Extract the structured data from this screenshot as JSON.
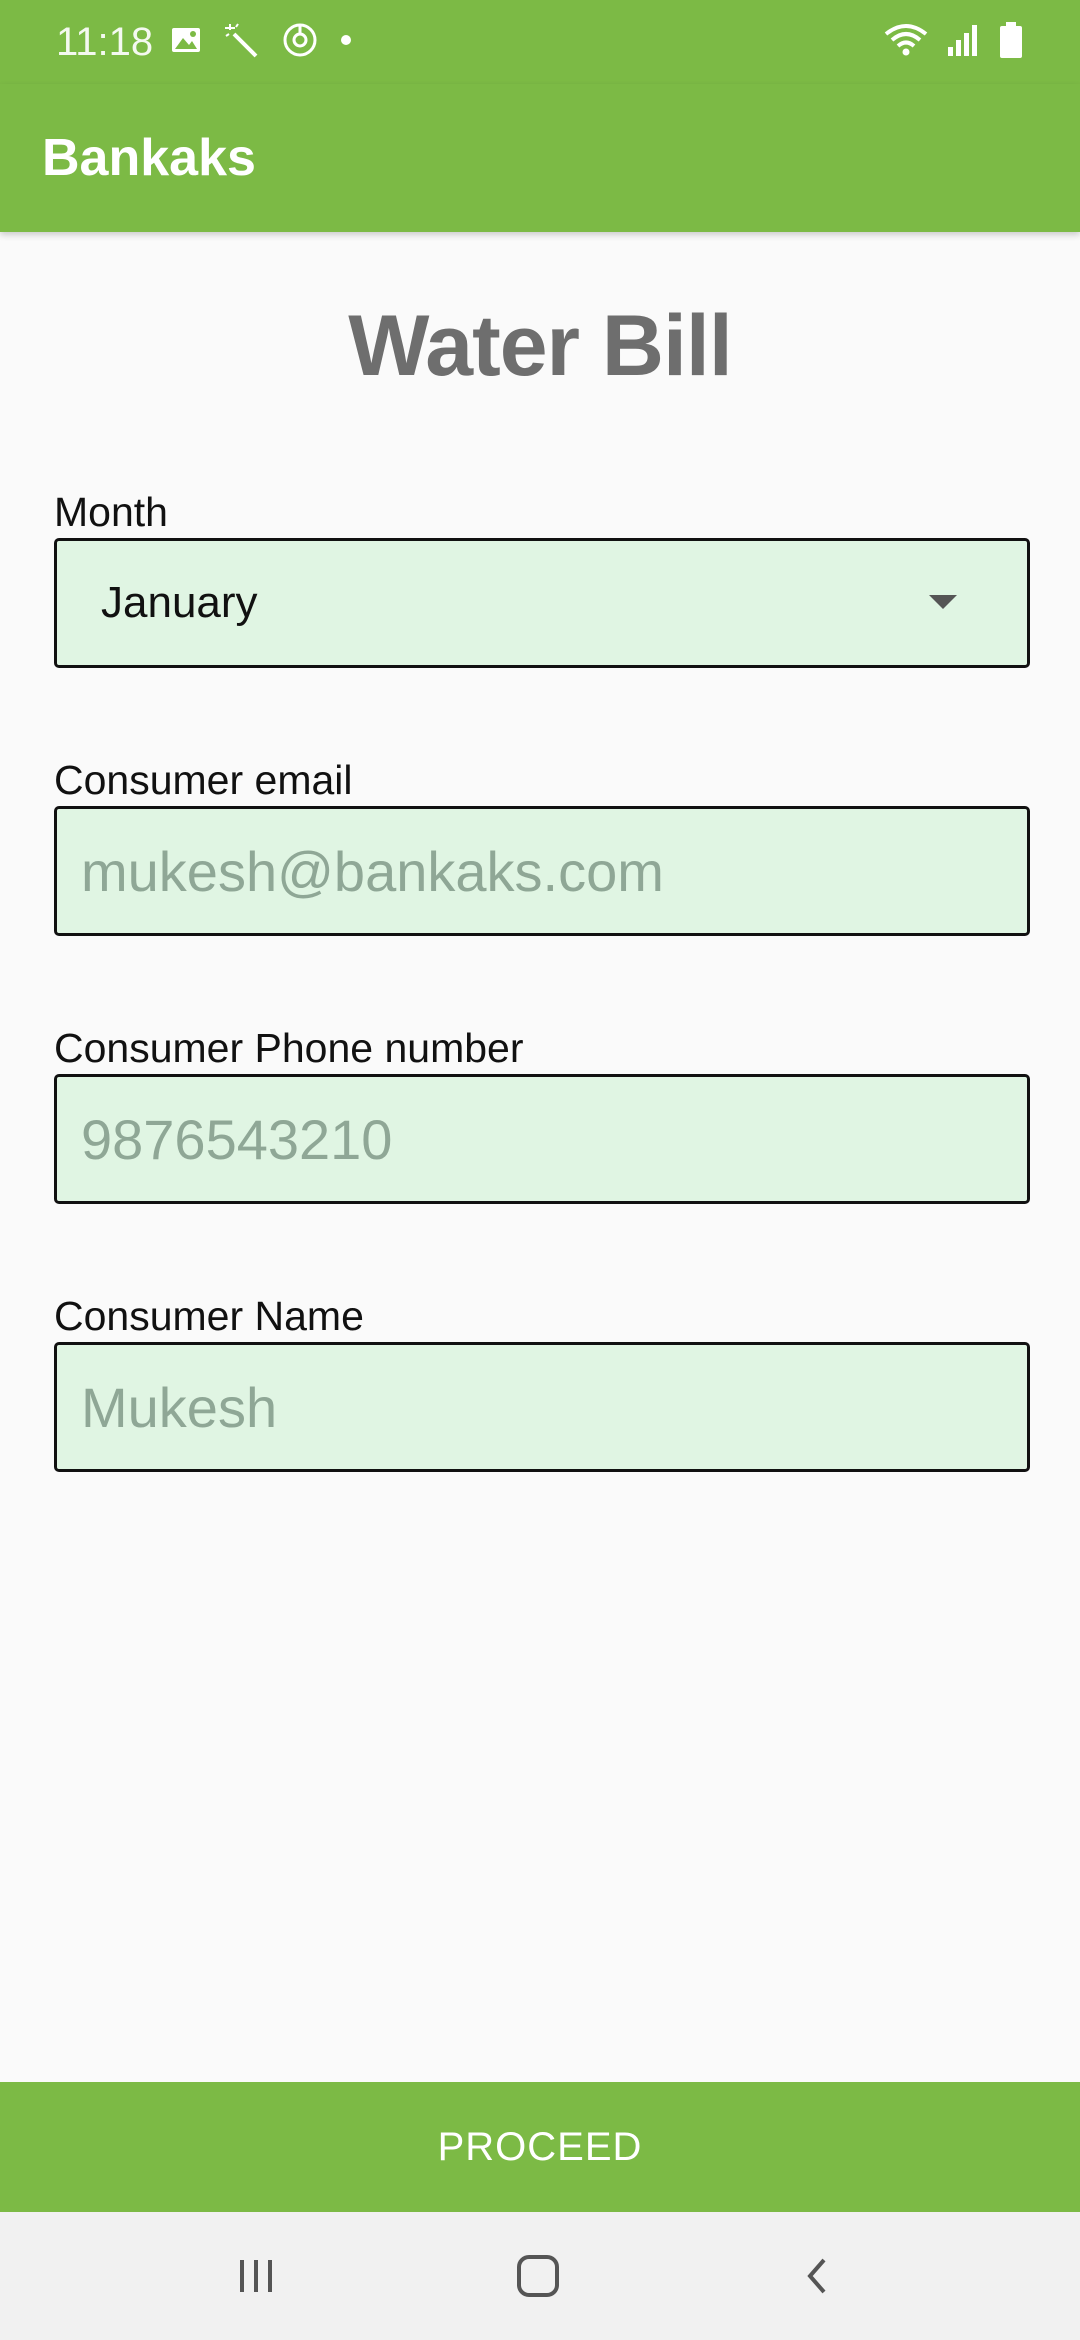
{
  "status_bar": {
    "time": "11:18",
    "left_icons": [
      "image-icon",
      "magic-wand-icon",
      "sync-icon",
      "dot-icon"
    ],
    "right_icons": [
      "wifi-icon",
      "signal-icon",
      "battery-icon"
    ]
  },
  "app_bar": {
    "title": "Bankaks"
  },
  "page": {
    "title": "Water Bill"
  },
  "form": {
    "month": {
      "label": "Month",
      "selected": "January"
    },
    "email": {
      "label": "Consumer email",
      "placeholder": "mukesh@bankaks.com"
    },
    "phone": {
      "label": "Consumer Phone number",
      "placeholder": "9876543210"
    },
    "name": {
      "label": "Consumer Name",
      "placeholder": "Mukesh"
    }
  },
  "proceed_label": "PROCEED",
  "nav_bar": {
    "buttons": [
      "recent-apps-icon",
      "home-icon",
      "back-icon"
    ]
  },
  "colors": {
    "brand": "#7CBA45",
    "field_bg": "#E0F5E3",
    "title_gray": "#6E6E6E"
  }
}
